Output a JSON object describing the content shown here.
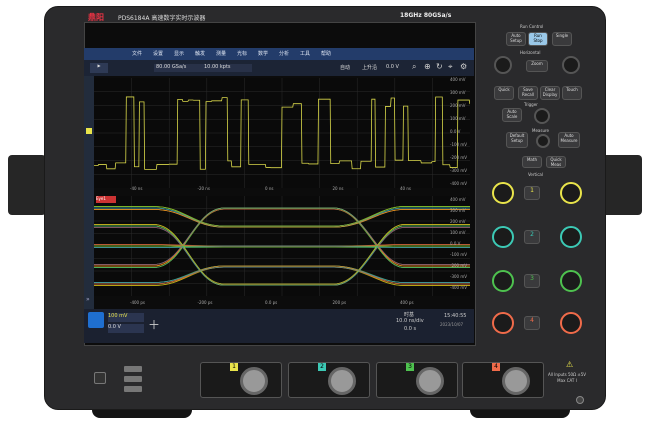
{
  "brand": {
    "logo": "鼎阳 logo",
    "name": "鼎阳"
  },
  "model_title": "PDS6184A 高速数字实时示波器",
  "spec": "18GHz 80GSa/s",
  "menu": [
    "文件",
    "设置",
    "显示",
    "触发",
    "测量",
    "光标",
    "数学",
    "分析",
    "工具",
    "帮助"
  ],
  "toolbar": {
    "sample_rate": "80.00 GSa/s",
    "record_length": "10.00 kpts",
    "trigger_mode": "自动",
    "trigger_type": "上升沿",
    "trigger_level": "0.0 V"
  },
  "waveform_top": {
    "y_labels": [
      "400 mV",
      "300 mV",
      "200 mV",
      "100 mV",
      "0.0 V",
      "-100 mV",
      "-200 mV",
      "-300 mV",
      "-400 mV"
    ],
    "x_labels": [
      "-40 ns",
      "-20 ns",
      "0 ns",
      "20 ns",
      "40 ns"
    ]
  },
  "eye": {
    "y_labels": [
      "400 mV",
      "300 mV",
      "200 mV",
      "100 mV",
      "0.0 V",
      "-100 mV",
      "-200 mV",
      "-300 mV",
      "-400 mV"
    ],
    "x_labels": [
      "-400 ps",
      "-200 ps",
      "0.0 ps",
      "200 ps",
      "400 ps"
    ]
  },
  "bottom": {
    "channel_scale": "100 mV",
    "channel_offset": "0.0 V",
    "timebase": "10.0 ns/div",
    "timebase_label": "时基",
    "delay": "0.0 s",
    "clock_time": "15:40:55",
    "clock_date": "2023/10/07"
  },
  "controls": {
    "run_control": "Run Control",
    "auto_setup": "Auto Setup",
    "run_stop": "Run Stop",
    "single": "Single",
    "horizontal": "Horizontal",
    "zoom": "Zoom",
    "quick": "Quick",
    "save_recall": "Save Recall",
    "clear_display": "Clear Display",
    "touch": "Touch",
    "trigger": "Trigger",
    "auto_scale": "Auto Scale",
    "default_setup": "Default Setup",
    "measure": "Measure",
    "auto_measure": "Auto Measure",
    "math": "Math",
    "quick_meas": "Quick Meas",
    "vertical": "Vertical",
    "ch1": "1",
    "ch2": "2",
    "ch3": "3",
    "ch4": "4"
  },
  "front": {
    "inputs_note": "All Inputs 50Ω ±5V Max CAT I"
  },
  "colors": {
    "ch1": "#e9e44b",
    "ch2": "#3cc9b5",
    "ch3": "#4ec24f",
    "ch4": "#f06b4a",
    "menubar": "#233c6a"
  }
}
